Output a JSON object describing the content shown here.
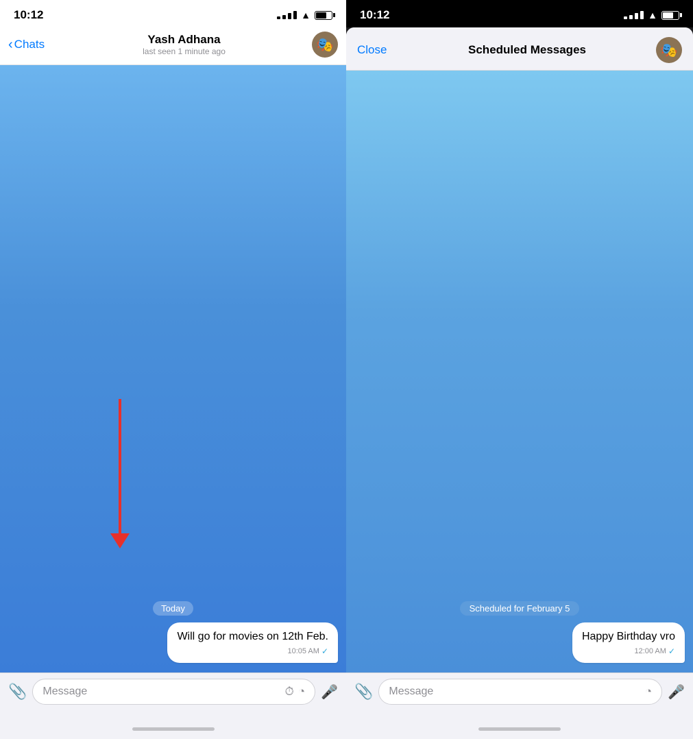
{
  "left_phone": {
    "status_bar": {
      "time": "10:12"
    },
    "nav": {
      "back_label": "Chats",
      "contact_name": "Yash Adhana",
      "contact_status": "last seen 1 minute ago",
      "avatar_emoji": "🎭"
    },
    "chat": {
      "date_label": "Today",
      "message_text": "Will go for movies on 12th Feb.",
      "message_time": "10:05 AM",
      "message_check": "✓"
    },
    "input_bar": {
      "placeholder": "Message",
      "attach_icon": "📎",
      "schedule_icon": "⏱",
      "emoji_icon": "🌙",
      "mic_icon": "🎤"
    }
  },
  "right_phone": {
    "status_bar": {
      "time": "10:12"
    },
    "modal": {
      "close_label": "Close",
      "title": "Scheduled Messages",
      "avatar_emoji": "🎭"
    },
    "chat": {
      "scheduled_label": "Scheduled for February 5",
      "message_text": "Happy Birthday vro",
      "message_time": "12:00 AM",
      "message_check": "✓"
    },
    "input_bar": {
      "placeholder": "Message",
      "attach_icon": "📎",
      "emoji_icon": "🌙",
      "mic_icon": "🎤"
    }
  }
}
